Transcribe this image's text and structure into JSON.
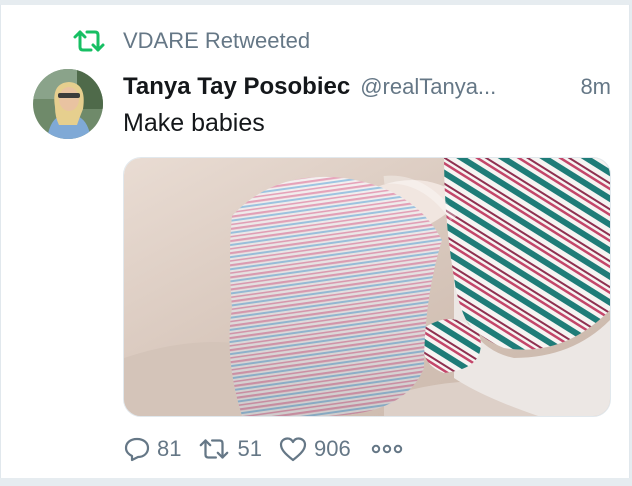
{
  "retweet_context": {
    "label": "VDARE Retweeted",
    "icon": "retweet-icon",
    "color": "#17bf63"
  },
  "author": {
    "display_name": "Tanya Tay Posobiec",
    "handle": "@realTanya...",
    "avatar_icon": "avatar"
  },
  "timestamp": "8m",
  "tweet_text": "Make babies",
  "media": {
    "icon": "photo"
  },
  "actions": {
    "reply_count": "81",
    "retweet_count": "51",
    "like_count": "906",
    "more_icon": "more-icon"
  },
  "colors": {
    "muted": "#657786",
    "text": "#14171a",
    "retweet_green": "#17bf63"
  }
}
